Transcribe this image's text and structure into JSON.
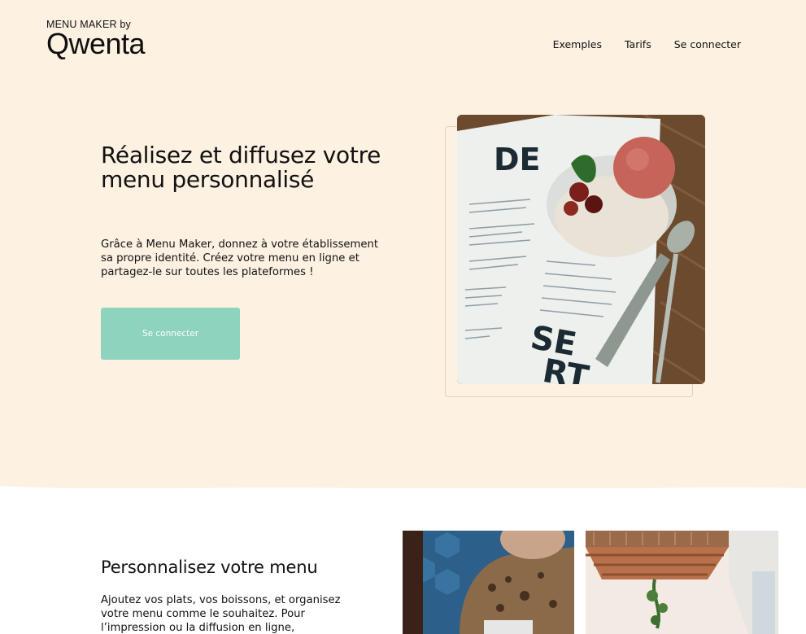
{
  "brand": {
    "tagline": "MENU MAKER by",
    "name": "Qwenta"
  },
  "nav": {
    "items": [
      "Exemples",
      "Tarifs",
      "Se connecter"
    ]
  },
  "hero": {
    "title": "Réalisez et diffusez votre menu personnalisé",
    "description": "Grâce à Menu Maker, donnez à votre établissement sa propre identité. Créez votre menu en ligne et partagez-le sur toutes les plateformes !",
    "cta_label": "Se connecter",
    "image": {
      "word_top": "DE",
      "word_bottom_1": "SE",
      "word_bottom_2": "RT"
    }
  },
  "section2": {
    "title": "Personnalisez votre menu",
    "description": "Ajoutez vos plats, vos boissons, et organisez votre menu comme le souhaitez. Pour l’impression ou la diffusion en ligne,"
  },
  "colors": {
    "hero_bg": "#fdf1e2",
    "accent": "#8dd3bd",
    "text": "#111111"
  }
}
